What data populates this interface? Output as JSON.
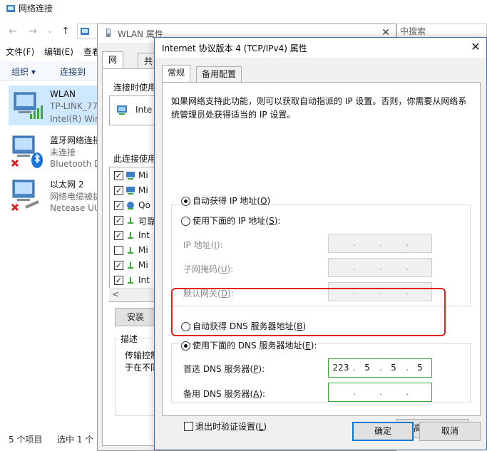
{
  "explorer": {
    "title": "网络连接",
    "search_placeholder": "中搜索",
    "menu": [
      "文件(F)",
      "编辑(E)",
      "查看"
    ],
    "commands": [
      "组织 ▾",
      "连接到"
    ],
    "items": [
      {
        "name": "WLAN",
        "line2": "TP-LINK_77",
        "line3": "Intel(R) Wir"
      },
      {
        "name": "蓝牙网络连接",
        "line2": "未连接",
        "line3": "Bluetooth D"
      },
      {
        "name": "以太网 2",
        "line2": "网络电缆被拔",
        "line3": "Netease UU"
      }
    ],
    "status_count": "5 个项目",
    "status_selected": "选中 1 个"
  },
  "wlan": {
    "title": "WLAN 属性",
    "tab_network": "网络",
    "tab_share": "共享",
    "connect_using": "连接时使用",
    "adapter_short": "Inte",
    "uses_items": "此连接使用",
    "components": [
      {
        "label": "Mi",
        "checked": true
      },
      {
        "label": "Mi",
        "checked": true
      },
      {
        "label": "Qo",
        "checked": true
      },
      {
        "label": "可靠",
        "checked": true
      },
      {
        "label": "Int",
        "checked": true
      },
      {
        "label": "Mi",
        "checked": false
      },
      {
        "label": "Mi",
        "checked": true
      },
      {
        "label": "Int",
        "checked": true
      }
    ],
    "scroll_left": "<",
    "install": "安装",
    "description_title": "描述",
    "description_line1": "传输控制",
    "description_line2": "于在不同"
  },
  "tcp": {
    "title": "Internet 协议版本 4 (TCP/IPv4) 属性",
    "tab_general": "常规",
    "tab_alternate": "备用配置",
    "description": "如果网络支持此功能，则可以获取自动指派的 IP 设置。否则，你需要从网络系统管理员处获得适当的 IP 设置。",
    "auto_ip": {
      "text": "自动获得 IP 地址(",
      "key": "O",
      "end": ")"
    },
    "manual_ip": {
      "text": "使用下面的 IP 地址(",
      "key": "S",
      "end": "):"
    },
    "ip_label": {
      "text": "IP 地址(",
      "key": "I",
      "end": "):"
    },
    "mask_label": {
      "text": "子网掩码(",
      "key": "U",
      "end": "):"
    },
    "gateway_label": {
      "text": "默认网关(",
      "key": "D",
      "end": "):"
    },
    "auto_dns": {
      "text": "自动获得 DNS 服务器地址(",
      "key": "B",
      "end": ")"
    },
    "manual_dns": {
      "text": "使用下面的 DNS 服务器地址(",
      "key": "E",
      "end": "):"
    },
    "preferred_dns_label": {
      "text": "首选 DNS 服务器(",
      "key": "P",
      "end": "):"
    },
    "alternate_dns_label": {
      "text": "备用 DNS 服务器(",
      "key": "A",
      "end": "):"
    },
    "preferred_dns": [
      "223",
      "5",
      "5",
      "5"
    ],
    "alternate_dns": [
      "",
      "",
      "",
      ""
    ],
    "ip_selected_mode": "auto",
    "dns_selected_mode": "manual",
    "validate": {
      "text": "退出时验证设置(",
      "key": "L",
      "end": ")",
      "checked": false
    },
    "advanced": {
      "text": "高级(",
      "key": "V",
      "end": ")..."
    },
    "ok": "确定",
    "cancel": "取消",
    "close_glyph": "✕",
    "colors": {
      "highlight": "#e8201a",
      "primary_border": "#0078d7"
    }
  }
}
